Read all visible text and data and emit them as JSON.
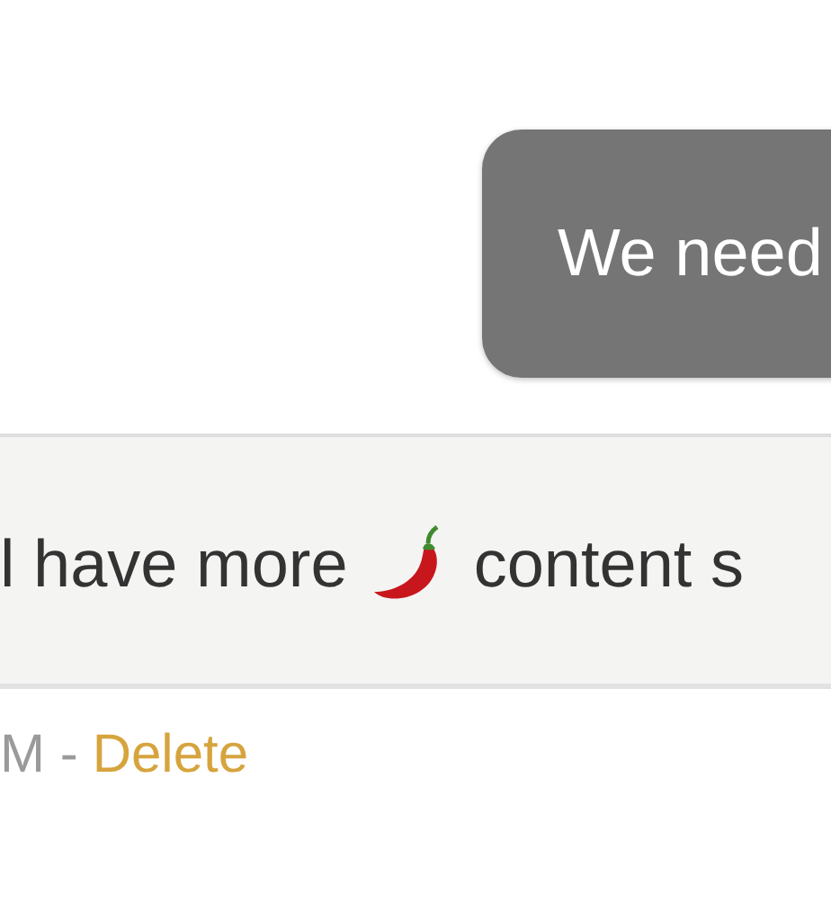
{
  "outgoing_message": {
    "text": "We need"
  },
  "incoming_message": {
    "parts": [
      {
        "kind": "text",
        "text": "l have more"
      },
      {
        "kind": "chili"
      },
      {
        "kind": "text",
        "text": "content s"
      }
    ]
  },
  "message_meta": {
    "time": "M -",
    "action": "Delete"
  }
}
